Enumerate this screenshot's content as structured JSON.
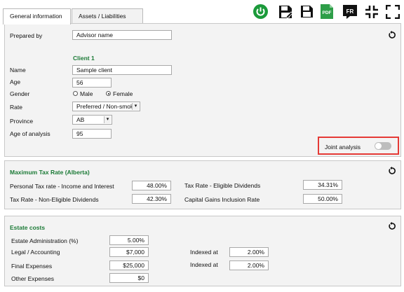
{
  "tabs": [
    {
      "label": "General information",
      "active": true
    },
    {
      "label": "Assets / Liabilities",
      "active": false
    }
  ],
  "toolbar": {
    "icons": [
      "power-icon",
      "save-as-icon",
      "save-icon",
      "pdf-icon",
      "language-icon",
      "collapse-icon",
      "expand-icon"
    ],
    "pdf_label": "PDF",
    "language_label": "FR"
  },
  "general": {
    "prepared_by_label": "Prepared by",
    "prepared_by_value": "Advisor name",
    "client_heading": "Client 1",
    "name_label": "Name",
    "name_value": "Sample client",
    "age_label": "Age",
    "age_value": "56",
    "gender_label": "Gender",
    "gender_options": [
      "Male",
      "Female"
    ],
    "gender_selected": "Female",
    "rate_label": "Rate",
    "rate_value": "Preferred / Non-smoke",
    "province_label": "Province",
    "province_value": "AB",
    "age_analysis_label": "Age of analysis",
    "age_analysis_value": "95",
    "joint_label": "Joint analysis",
    "joint_on": false
  },
  "tax": {
    "title": "Maximum Tax Rate (Alberta)",
    "personal_label": "Personal Tax rate - Income and Interest",
    "personal_value": "48.00%",
    "non_eligible_label": "Tax Rate - Non-Eligible Dividends",
    "non_eligible_value": "42.30%",
    "eligible_label": "Tax Rate - Eligible Dividends",
    "eligible_value": "34.31%",
    "capital_label": "Capital Gains Inclusion Rate",
    "capital_value": "50.00%"
  },
  "estate": {
    "title": "Estate costs",
    "admin_label": "Estate Administration (%)",
    "admin_value": "5.00%",
    "legal_label": "Legal / Accounting",
    "legal_value": "$7,000",
    "final_label": "Final Expenses",
    "final_value": "$25,000",
    "other_label": "Other Expenses",
    "other_value": "$0",
    "indexed_label_1": "Indexed at",
    "indexed_value_1": "2.00%",
    "indexed_label_2": "Indexed at",
    "indexed_value_2": "2.00%"
  },
  "colors": {
    "accent_green": "#1b9a3a",
    "heading_green": "#1b7a36",
    "highlight_red": "#e53935",
    "panel_bg": "#f3f3f3"
  }
}
